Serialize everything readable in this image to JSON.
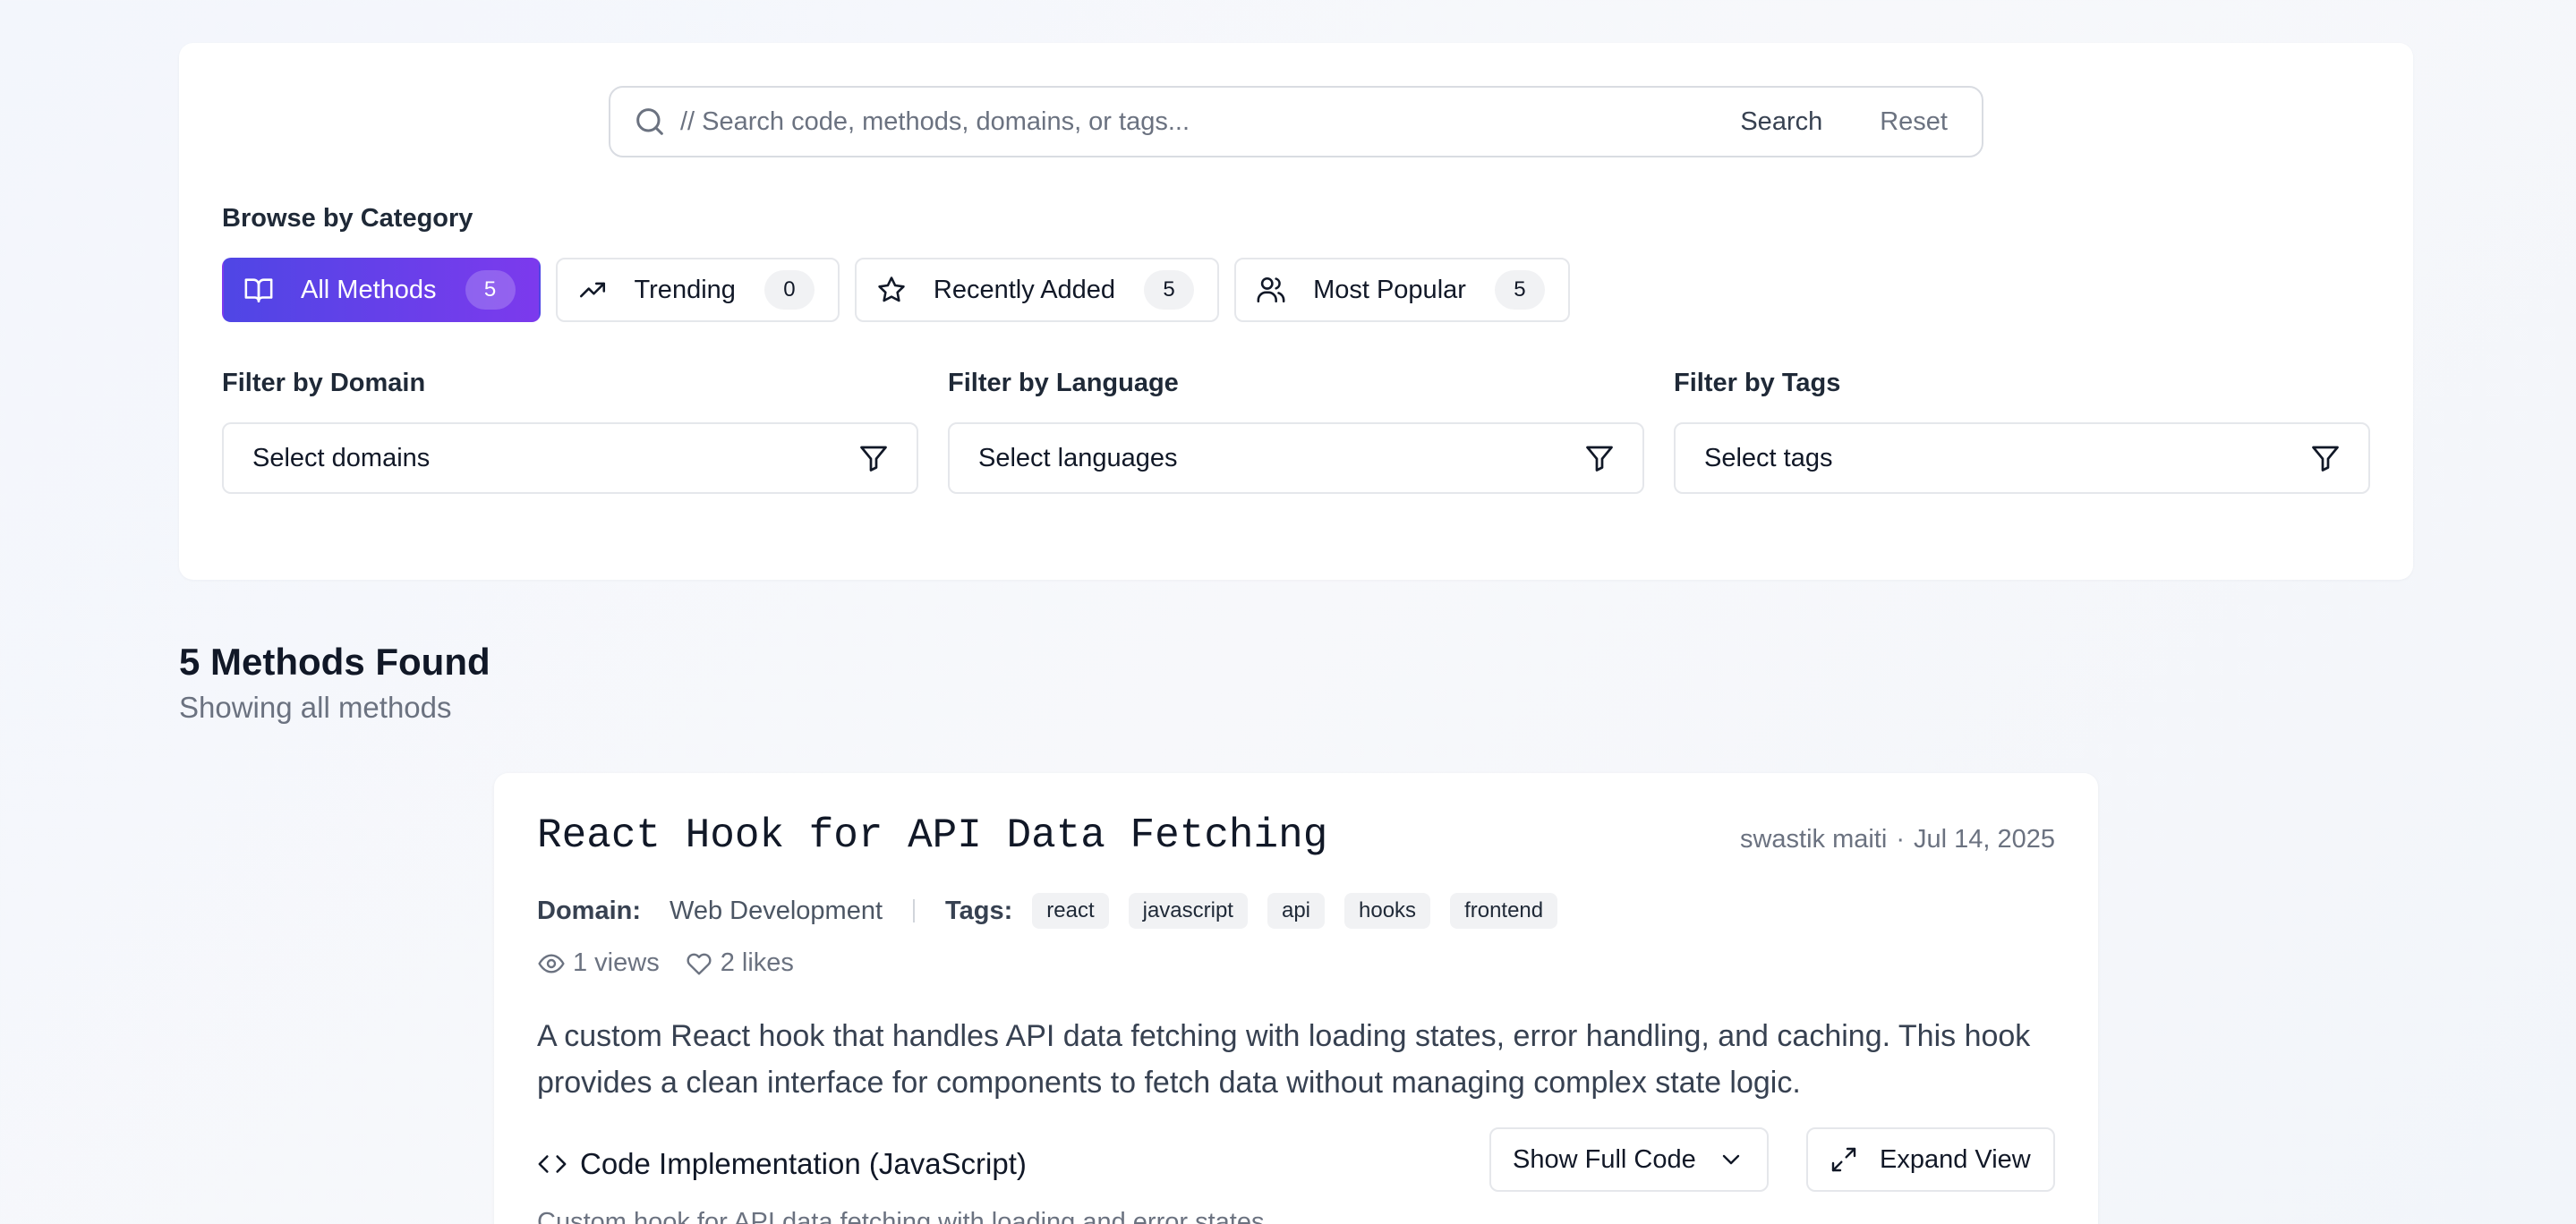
{
  "search": {
    "placeholder": "// Search code, methods, domains, or tags...",
    "value": "",
    "search_label": "Search",
    "reset_label": "Reset",
    "icon": "search-icon"
  },
  "browse": {
    "heading": "Browse by Category",
    "categories": [
      {
        "label": "All Methods",
        "count": "5",
        "icon": "book-open-icon",
        "active": true
      },
      {
        "label": "Trending",
        "count": "0",
        "icon": "trending-up-icon",
        "active": false
      },
      {
        "label": "Recently Added",
        "count": "5",
        "icon": "star-icon",
        "active": false
      },
      {
        "label": "Most Popular",
        "count": "5",
        "icon": "users-icon",
        "active": false
      }
    ]
  },
  "filters": {
    "domain": {
      "label": "Filter by Domain",
      "value": "Select domains"
    },
    "language": {
      "label": "Filter by Language",
      "value": "Select languages"
    },
    "tags": {
      "label": "Filter by Tags",
      "value": "Select tags"
    }
  },
  "results": {
    "title": "5 Methods Found",
    "subtitle": "Showing all methods"
  },
  "card": {
    "title": "React Hook for API Data Fetching",
    "author": "swastik maiti",
    "dot": "·",
    "date": "Jul 14, 2025",
    "domain_label": "Domain:",
    "domain": "Web Development",
    "tags_label": "Tags:",
    "tags": [
      "react",
      "javascript",
      "api",
      "hooks",
      "frontend"
    ],
    "views": "1 views",
    "likes": "2 likes",
    "description": "A custom React hook that handles API data fetching with loading states, error handling, and caching. This hook provides a clean interface for components to fetch data without managing complex state logic.",
    "code_heading": "Code Implementation (JavaScript)",
    "show_code_label": "Show Full Code",
    "expand_label": "Expand View",
    "code_caption": "Custom hook for API data fetching with loading and error states"
  },
  "colors": {
    "accent_start": "#4f46e5",
    "accent_end": "#7c3aed",
    "muted_text": "#6b7280"
  }
}
